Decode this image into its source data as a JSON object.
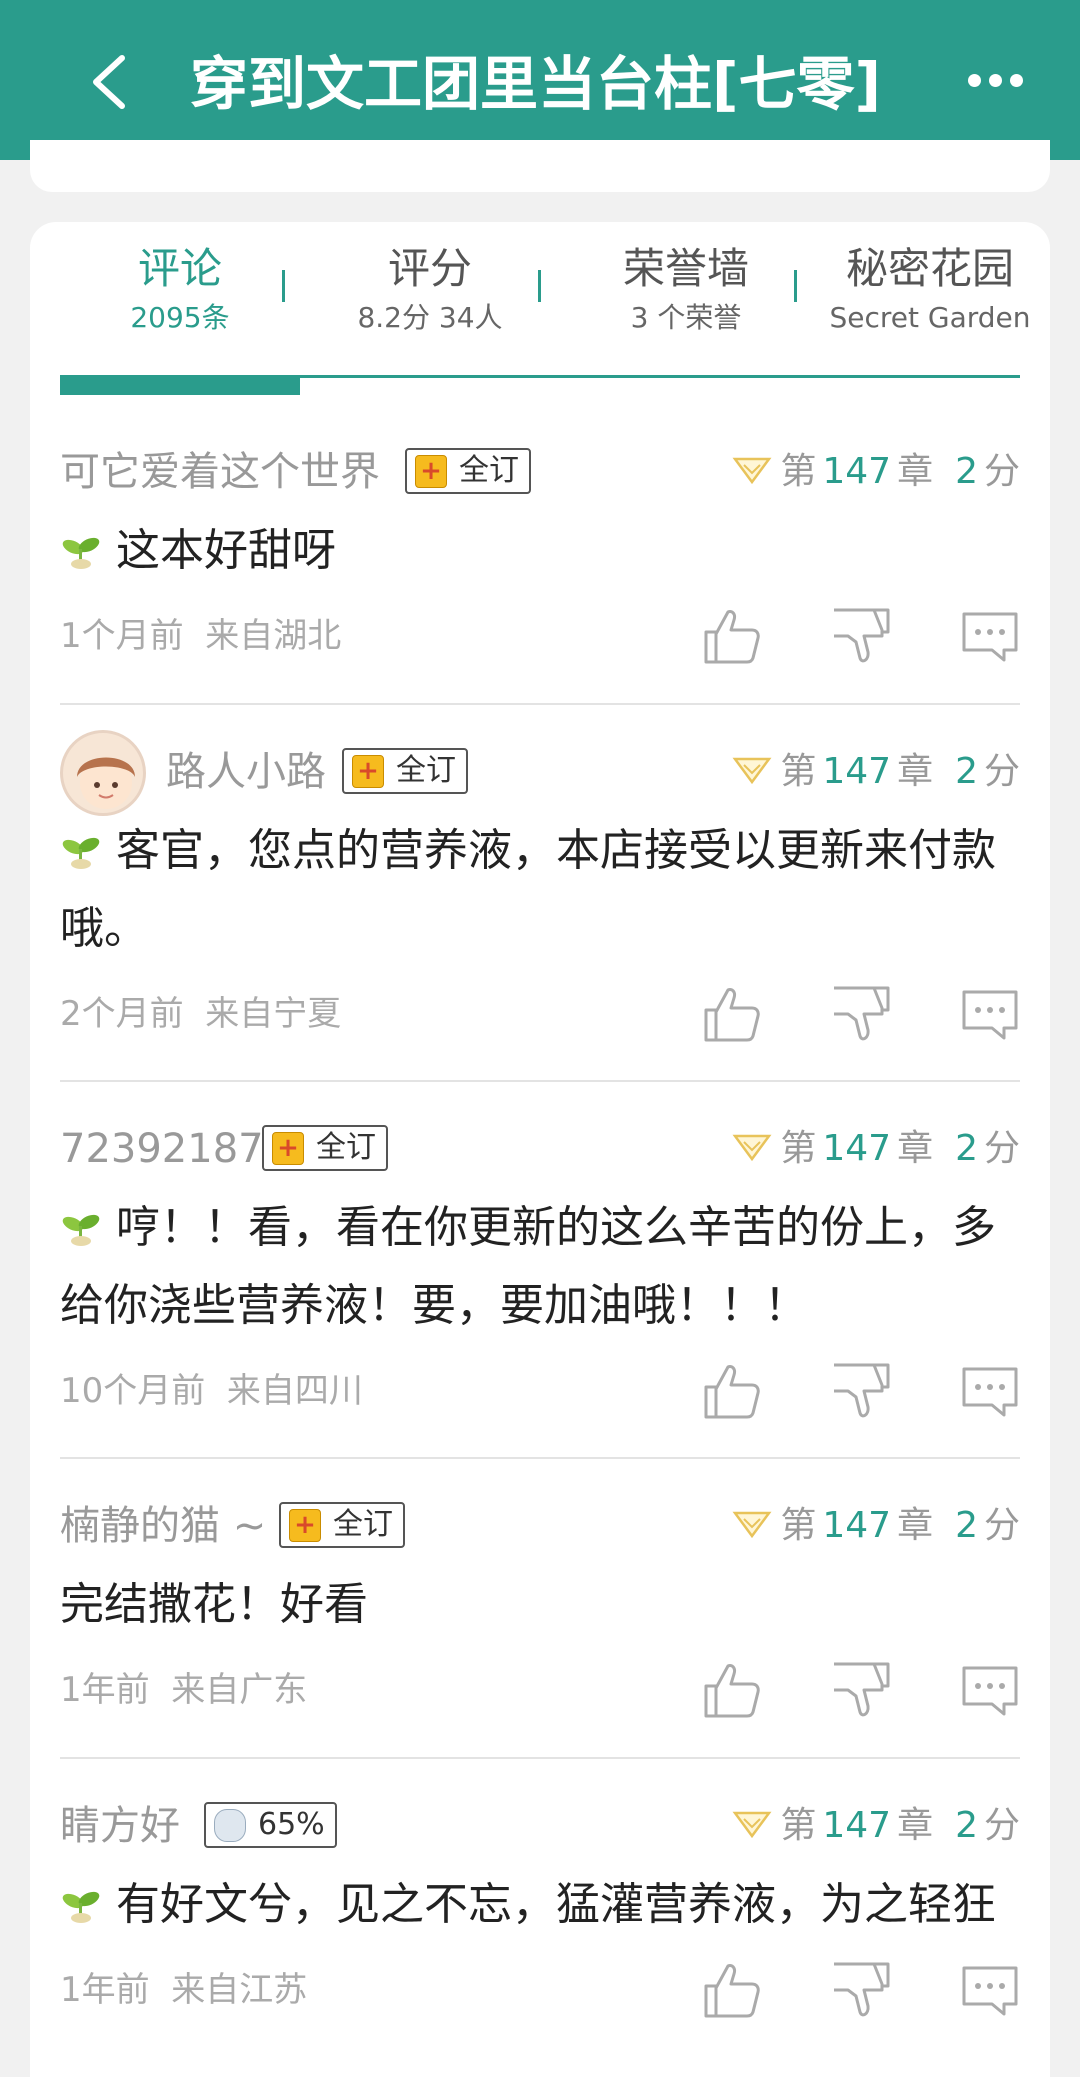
{
  "header": {
    "title": "穿到文工团里当台柱[七零]",
    "back_icon": "chevron-left-icon",
    "more_icon": "more-dots-icon"
  },
  "tabs": [
    {
      "label": "评论",
      "sub": "2095条",
      "active": true
    },
    {
      "label": "评分",
      "sub": "8.2分 34人",
      "active": false
    },
    {
      "label": "荣誉墙",
      "sub": "3 个荣誉",
      "active": false
    },
    {
      "label": "秘密花园",
      "sub": "Secret Garden",
      "active": false
    }
  ],
  "comments": [
    {
      "user": "可它爱着这个世界",
      "badge": "全订",
      "chapter_prefix": "第",
      "chapter": "147",
      "chapter_suffix": "章",
      "score": "2",
      "score_suffix": "分",
      "text": "这本好甜呀",
      "time": "1个月前",
      "location": "来自湖北"
    },
    {
      "user": "路人小路",
      "badge": "全订",
      "chapter_prefix": "第",
      "chapter": "147",
      "chapter_suffix": "章",
      "score": "2",
      "score_suffix": "分",
      "text": "客官，您点的营养液，本店接受以更新来付款哦。",
      "time": "2个月前",
      "location": "来自宁夏"
    },
    {
      "user": "72392187",
      "badge": "全订",
      "chapter_prefix": "第",
      "chapter": "147",
      "chapter_suffix": "章",
      "score": "2",
      "score_suffix": "分",
      "text": "哼！！看，看在你更新的这么辛苦的份上，多给你浇些营养液！要，要加油哦！！！",
      "time": "10个月前",
      "location": "来自四川"
    },
    {
      "user": "楠静的猫 ~",
      "badge": "全订",
      "chapter_prefix": "第",
      "chapter": "147",
      "chapter_suffix": "章",
      "score": "2",
      "score_suffix": "分",
      "text": "完结撒花！好看",
      "time": "1年前",
      "location": "来自广东"
    },
    {
      "user": "睛方好",
      "badge": "65%",
      "chapter_prefix": "第",
      "chapter": "147",
      "chapter_suffix": "章",
      "score": "2",
      "score_suffix": "分",
      "text": "有好文兮，见之不忘，猛灌营养液，为之轻狂",
      "time": "1年前",
      "location": "来自江苏"
    }
  ],
  "colors": {
    "accent": "#2a9c8c",
    "badge_gold": "#f6bb1e"
  }
}
